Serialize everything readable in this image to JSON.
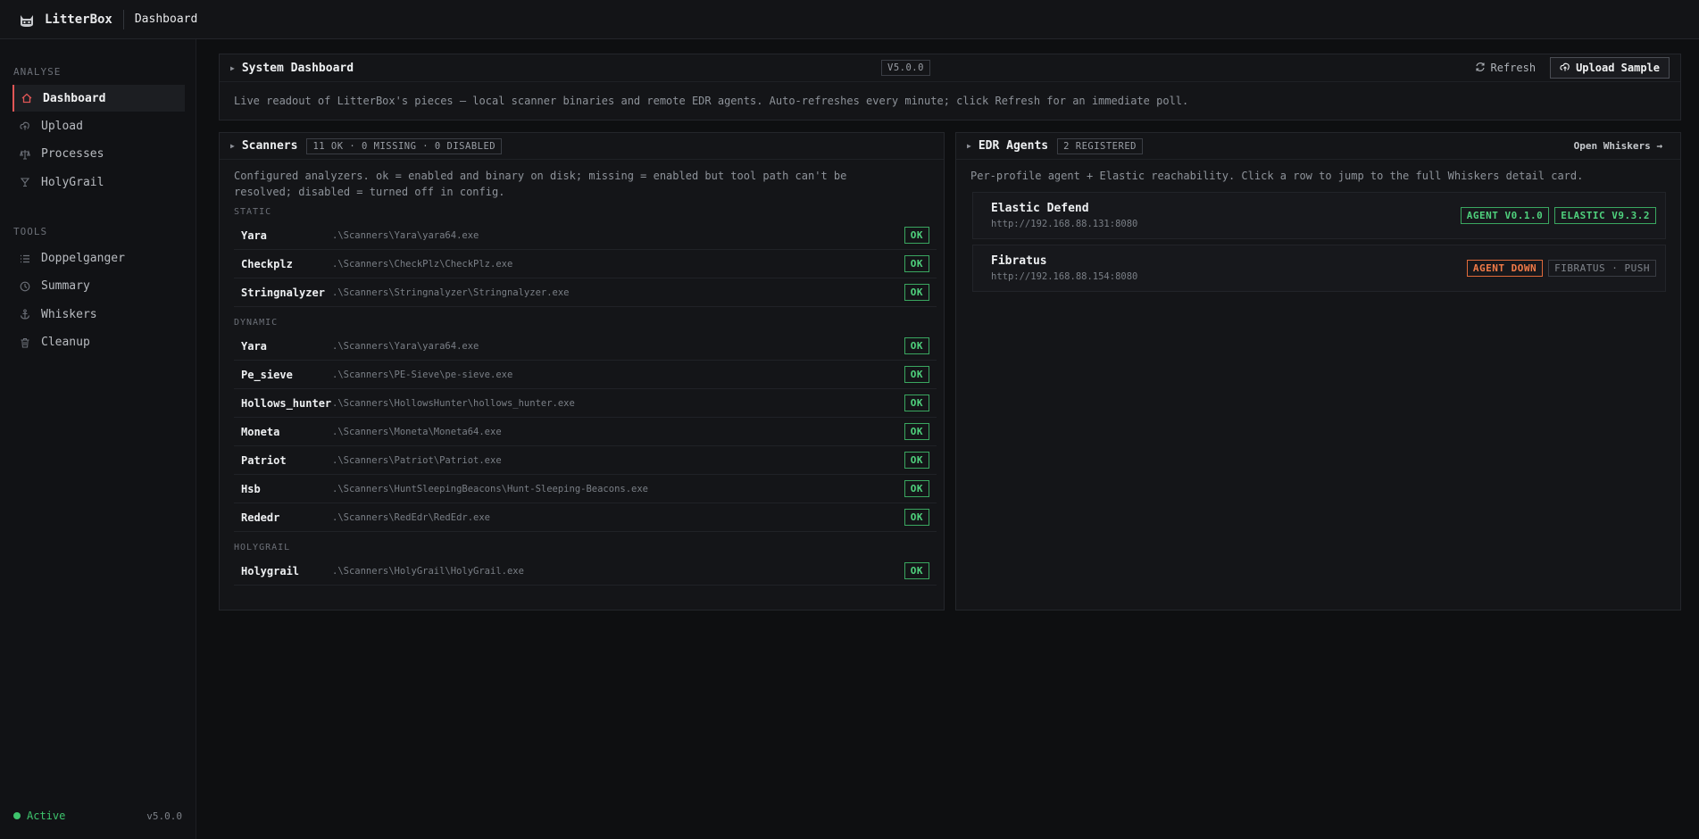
{
  "topbar": {
    "brand": "LitterBox",
    "page": "Dashboard"
  },
  "sidebar": {
    "sections": [
      {
        "label": "ANALYSE",
        "items": [
          {
            "label": "Dashboard",
            "icon": "home-icon",
            "active": true
          },
          {
            "label": "Upload",
            "icon": "upload-icon"
          },
          {
            "label": "Processes",
            "icon": "scale-icon"
          },
          {
            "label": "HolyGrail",
            "icon": "grail-icon"
          }
        ]
      },
      {
        "label": "TOOLS",
        "items": [
          {
            "label": "Doppelganger",
            "icon": "list-icon"
          },
          {
            "label": "Summary",
            "icon": "clock-icon"
          },
          {
            "label": "Whiskers",
            "icon": "anchor-icon"
          },
          {
            "label": "Cleanup",
            "icon": "trash-icon"
          }
        ]
      }
    ],
    "status": "Active",
    "version": "v5.0.0"
  },
  "system": {
    "title": "System Dashboard",
    "version_tag": "V5.0.0",
    "refresh": "Refresh",
    "upload": "Upload Sample",
    "description": "Live readout of LitterBox's pieces — local scanner binaries and remote EDR agents. Auto-refreshes every minute; click Refresh for an immediate poll."
  },
  "scanners": {
    "title": "Scanners",
    "tag": "11 OK · 0 MISSING · 0 DISABLED",
    "description": "Configured analyzers. ok = enabled and binary on disk; missing = enabled but tool path can't be resolved; disabled = turned off in config.",
    "groups": [
      {
        "label": "STATIC",
        "rows": [
          {
            "name": "Yara",
            "path": ".\\Scanners\\Yara\\yara64.exe",
            "status": "OK"
          },
          {
            "name": "Checkplz",
            "path": ".\\Scanners\\CheckPlz\\CheckPlz.exe",
            "status": "OK"
          },
          {
            "name": "Stringnalyzer",
            "path": ".\\Scanners\\Stringnalyzer\\Stringnalyzer.exe",
            "status": "OK"
          }
        ]
      },
      {
        "label": "DYNAMIC",
        "rows": [
          {
            "name": "Yara",
            "path": ".\\Scanners\\Yara\\yara64.exe",
            "status": "OK"
          },
          {
            "name": "Pe_sieve",
            "path": ".\\Scanners\\PE-Sieve\\pe-sieve.exe",
            "status": "OK"
          },
          {
            "name": "Hollows_hunter",
            "path": ".\\Scanners\\HollowsHunter\\hollows_hunter.exe",
            "status": "OK"
          },
          {
            "name": "Moneta",
            "path": ".\\Scanners\\Moneta\\Moneta64.exe",
            "status": "OK"
          },
          {
            "name": "Patriot",
            "path": ".\\Scanners\\Patriot\\Patriot.exe",
            "status": "OK"
          },
          {
            "name": "Hsb",
            "path": ".\\Scanners\\HuntSleepingBeacons\\Hunt-Sleeping-Beacons.exe",
            "status": "OK"
          },
          {
            "name": "Rededr",
            "path": ".\\Scanners\\RedEdr\\RedEdr.exe",
            "status": "OK"
          }
        ]
      },
      {
        "label": "HOLYGRAIL",
        "rows": [
          {
            "name": "Holygrail",
            "path": ".\\Scanners\\HolyGrail\\HolyGrail.exe",
            "status": "OK"
          }
        ]
      }
    ]
  },
  "edr": {
    "title": "EDR Agents",
    "tag": "2 REGISTERED",
    "open_link": "Open Whiskers →",
    "description": "Per-profile agent + Elastic reachability. Click a row to jump to the full Whiskers detail card.",
    "agents": [
      {
        "name": "Elastic Defend",
        "url": "http://192.168.88.131:8080",
        "badges": [
          {
            "text": "AGENT V0.1.0",
            "kind": "green"
          },
          {
            "text": "ELASTIC V9.3.2",
            "kind": "green"
          }
        ]
      },
      {
        "name": "Fibratus",
        "url": "http://192.168.88.154:8080",
        "badges": [
          {
            "text": "AGENT DOWN",
            "kind": "orange"
          },
          {
            "text": "FIBRATUS · PUSH",
            "kind": "muted"
          }
        ]
      }
    ]
  },
  "colors": {
    "accent_red": "#e05656",
    "ok_green": "#4fd17d",
    "warn_orange": "#f27b48"
  }
}
